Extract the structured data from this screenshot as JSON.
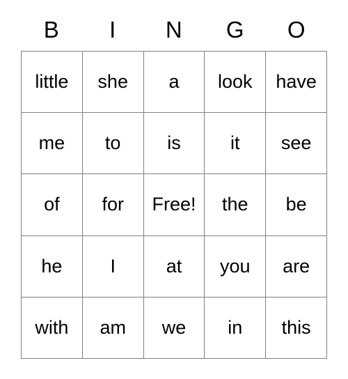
{
  "card": {
    "title_letters": [
      "B",
      "I",
      "N",
      "G",
      "O"
    ],
    "free_space_label": "Free!",
    "colors": {
      "background": "#ffffff",
      "border": "#808080",
      "text": "#000000"
    },
    "rows": [
      [
        "little",
        "she",
        "a",
        "look",
        "have"
      ],
      [
        "me",
        "to",
        "is",
        "it",
        "see"
      ],
      [
        "of",
        "for",
        "Free!",
        "the",
        "be"
      ],
      [
        "he",
        "I",
        "at",
        "you",
        "are"
      ],
      [
        "with",
        "am",
        "we",
        "in",
        "this"
      ]
    ]
  }
}
